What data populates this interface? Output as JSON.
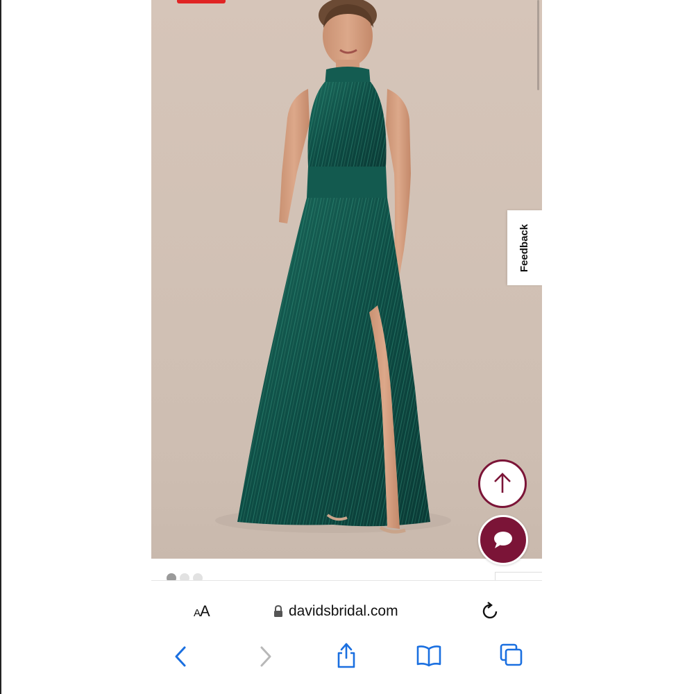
{
  "product": {
    "image_alt": "Model wearing a long green metallic halter-neck gown with a front slit",
    "image_count": 3,
    "active_image": 1
  },
  "feedback": {
    "label": "Feedback"
  },
  "buttons": {
    "scroll_top_icon": "arrow-up-icon",
    "chat_icon": "chat-bubble-icon"
  },
  "browser": {
    "text_size_label_small": "A",
    "text_size_label_large": "A",
    "url": "davidsbridal.com",
    "lock_icon": "lock-icon",
    "reload_icon": "reload-icon",
    "toolbar": [
      "back-icon",
      "forward-icon",
      "share-icon",
      "bookmarks-icon",
      "tabs-icon"
    ]
  },
  "colors": {
    "accent": "#7b1437",
    "safari_blue": "#1a6fe0",
    "sale_red": "#e02424",
    "dress_green": "#0f5149"
  }
}
